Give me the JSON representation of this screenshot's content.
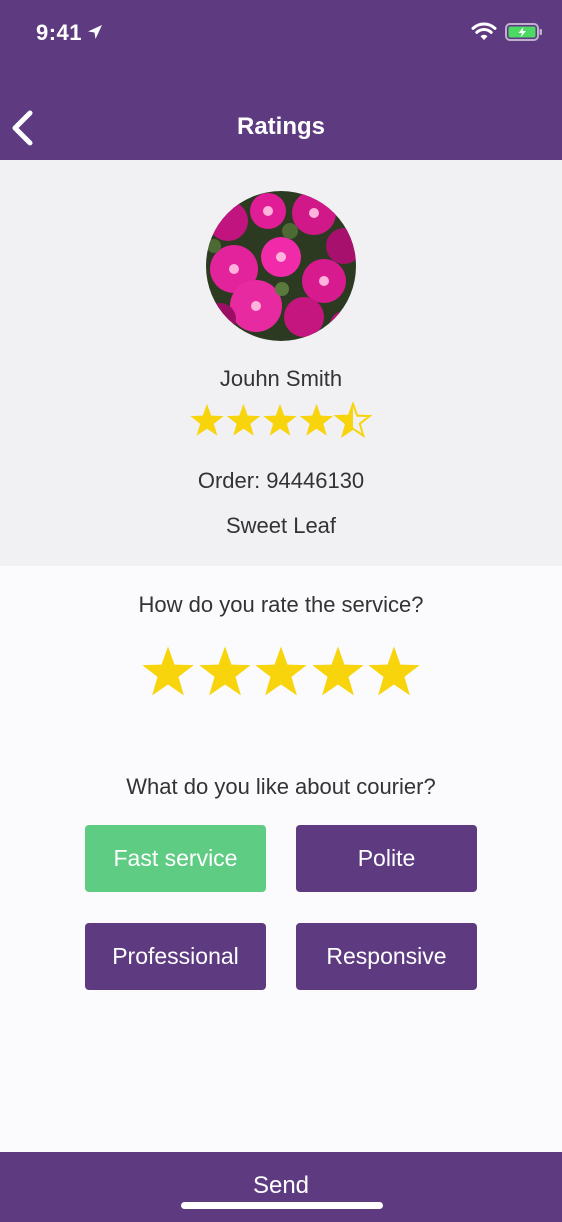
{
  "status_bar": {
    "time": "9:41"
  },
  "header": {
    "title": "Ratings"
  },
  "courier": {
    "name": "Jouhn Smith",
    "rating": 4.5,
    "rating_max": 5,
    "order_label": "Order: 94446130",
    "shop": "Sweet Leaf"
  },
  "service_rating": {
    "question": "How do you rate the service?",
    "value": 5,
    "max": 5
  },
  "feedback": {
    "question": "What do you like about courier?",
    "tags": [
      {
        "label": "Fast service",
        "selected": true
      },
      {
        "label": "Polite",
        "selected": false
      },
      {
        "label": "Professional",
        "selected": false
      },
      {
        "label": "Responsive",
        "selected": false
      }
    ]
  },
  "footer": {
    "send_label": "Send"
  },
  "colors": {
    "brand_purple": "#5e3b80",
    "selected_green": "#5fcc83",
    "star_yellow": "#f7d40b",
    "profile_bg": "#f1f0f3"
  },
  "icons": {
    "back": "chevron-left-icon",
    "location": "location-arrow-icon",
    "wifi": "wifi-icon",
    "battery": "battery-charging-icon"
  }
}
